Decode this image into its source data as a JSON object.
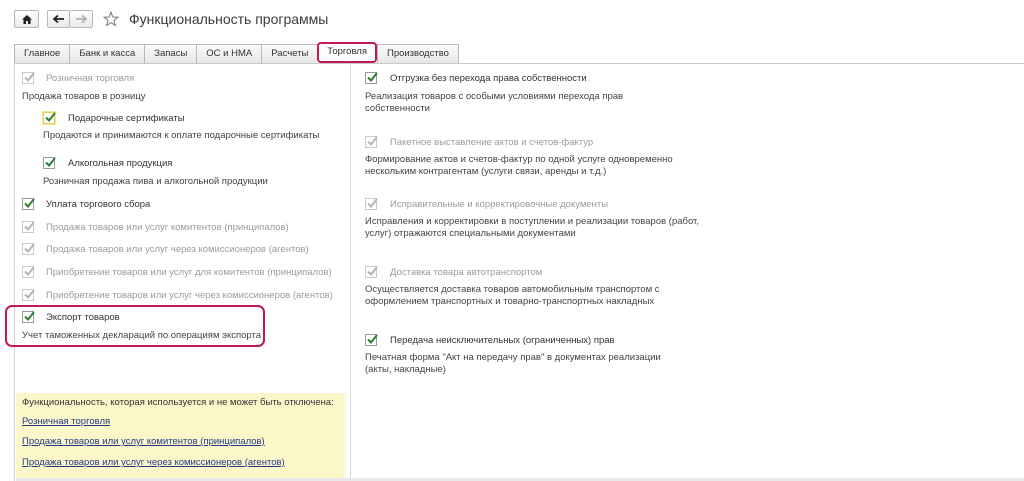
{
  "window": {
    "title": "Функциональность программы"
  },
  "tabs": [
    {
      "label": "Главное"
    },
    {
      "label": "Банк и касса"
    },
    {
      "label": "Запасы"
    },
    {
      "label": "ОС и НМА"
    },
    {
      "label": "Расчеты"
    },
    {
      "label": "Торговля"
    },
    {
      "label": "Производство"
    }
  ],
  "left": {
    "retail": {
      "label": "Розничная торговля",
      "desc": "Продажа товаров в розницу"
    },
    "gift": {
      "label": "Подарочные сертификаты",
      "desc": "Продаются и принимаются к оплате подарочные сертификаты"
    },
    "alcohol": {
      "label": "Алкогольная продукция",
      "desc": "Розничная продажа пива и алкогольной продукции"
    },
    "trade_fee": {
      "label": "Уплата торгового сбора"
    },
    "commit_sales": {
      "label": "Продажа товаров или услуг комитентов (принципалов)"
    },
    "agent_sales": {
      "label": "Продажа товаров или услуг через комиссионеров (агентов)"
    },
    "commit_purchase": {
      "label": "Приобретение товаров или услуг для комитентов (принципалов)"
    },
    "agent_purchase": {
      "label": "Приобретение товаров или услуг через комиссионеров (агентов)"
    },
    "export": {
      "label": "Экспорт товаров",
      "desc": "Учет таможенных деклараций по операциям экспорта"
    }
  },
  "right": {
    "no_ownership": {
      "label": "Отгрузка без перехода права собственности",
      "desc": "Реализация товаров с особыми условиями перехода прав собственности"
    },
    "batch_acts": {
      "label": "Пакетное выставление актов и счетов-фактур",
      "desc": "Формирование актов и счетов-фактур по одной услуге одновременно нескольким контрагентам (услуги связи, аренды и т.д.)"
    },
    "corrections": {
      "label": "Исправительные и корректировочные документы",
      "desc": "Исправления и корректировки в поступлении и реализации товаров (работ, услуг) отражаются специальными документами"
    },
    "delivery": {
      "label": "Доставка товара автотранспортом",
      "desc": "Осуществляется доставка товаров автомобильным транспортом с оформлением транспортных и товарно-транспортных накладных"
    },
    "rights": {
      "label": "Передача неисключительных (ограниченных) прав",
      "desc": "Печатная форма \"Акт на передачу прав\" в документах реализации (акты, накладные)"
    }
  },
  "info": {
    "caption": "Функциональность, которая используется и не может быть отключена:",
    "links": [
      "Розничная торговля",
      "Продажа товаров или услуг комитентов (принципалов)",
      "Продажа товаров или услуг через комиссионеров (агентов)"
    ]
  },
  "colors": {
    "highlight": "#c2185b",
    "check": "#2e7d32",
    "info_bg": "#fbf7c9",
    "link": "#233a8a"
  },
  "icons": [
    "home-icon",
    "back-arrow-icon",
    "forward-arrow-icon",
    "star-icon",
    "checkmark-icon"
  ]
}
